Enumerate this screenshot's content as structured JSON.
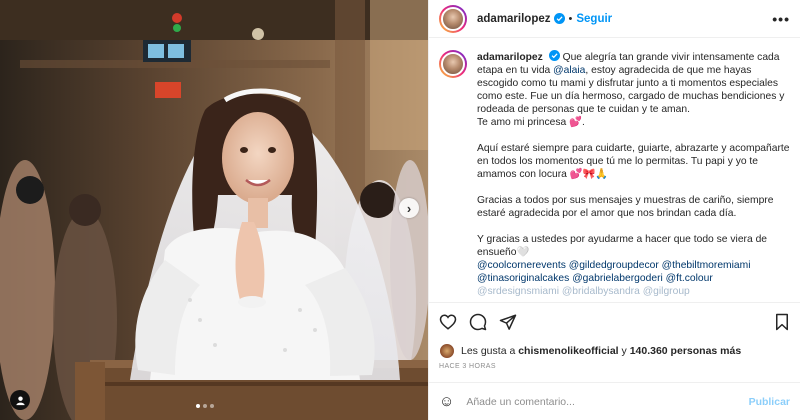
{
  "post": {
    "username": "adamarilopez",
    "follow_label": "Seguir",
    "more_label": "•••",
    "separator": "•"
  },
  "caption": {
    "username": "adamarilopez",
    "p1_a": "Que alegría tan grande vivir intensamente cada etapa en tu vida",
    "p1_mention": "@alaia",
    "p1_b": ", estoy agradecida de que me hayas escogido como tu mami y disfrutar junto a ti momentos especiales como este. Fue un día hermoso, cargado de muchas bendiciones y rodeada de personas que te cuidan y te aman.",
    "p1_c": "Te amo mi princesa 💕.",
    "p2": "Aquí estaré siempre para cuidarte, guiarte, abrazarte y acompañarte en todos los momentos que tú me lo permitas. Tu papi y yo te amamos con locura 💕🎀🙏",
    "p3": "Gracias a todos por sus mensajes y muestras de cariño, siempre estaré agradecida por el amor que nos brindan cada día.",
    "p4": "Y gracias a ustedes por ayudarme a hacer que todo se viera de ensueño🤍",
    "tags": [
      "@coolcornerevents",
      "@gildedgroupdecor",
      "@thebiltmoremiami",
      "@tinasoriginalcakes",
      "@gabrielabergoderi",
      "@ft.colour"
    ],
    "cut_line": "@srdesignsmiami @bridalbysandra @gilgroup"
  },
  "likes": {
    "prefix": "Les gusta a",
    "user": "chismenolikeofficial",
    "middle": "y",
    "count": "140.360 personas más"
  },
  "timestamp": "HACE 3 HORAS",
  "comment": {
    "emoji": "☺",
    "placeholder": "Añade un comentario...",
    "publish_label": "Publicar"
  },
  "carousel": {
    "next_arrow": "›",
    "dots": 3,
    "active_dot": 0
  },
  "colors": {
    "accent": "#0095f6",
    "mention": "#00376b",
    "text": "#262626",
    "muted": "#8e8e8e"
  },
  "icons": [
    "verified-badge-icon",
    "heart-icon",
    "comment-icon",
    "share-icon",
    "bookmark-icon",
    "emoji-icon",
    "user-tag-icon",
    "chevron-right-icon"
  ]
}
